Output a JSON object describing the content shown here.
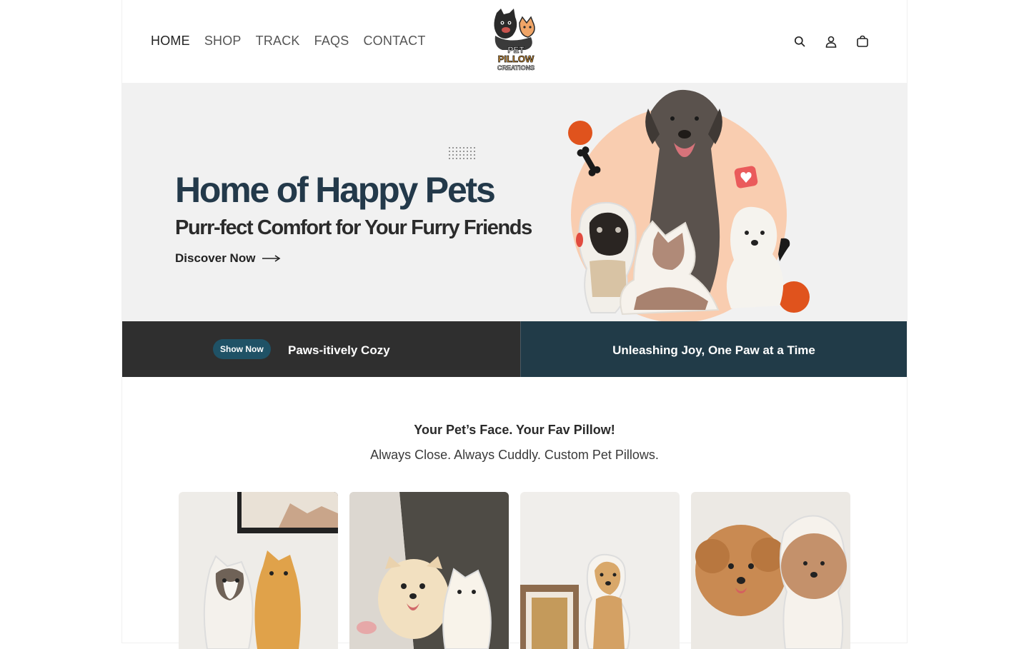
{
  "nav": {
    "items": [
      {
        "label": "HOME",
        "active": true
      },
      {
        "label": "SHOP"
      },
      {
        "label": "TRACK"
      },
      {
        "label": "FAQS"
      },
      {
        "label": "CONTACT"
      }
    ]
  },
  "logo": {
    "line1": "PET",
    "line2": "PILLOW",
    "line3": "CREATIONS"
  },
  "header_icons": [
    "search-icon",
    "account-icon",
    "cart-icon"
  ],
  "hero": {
    "title": "Home of Happy Pets",
    "subtitle": "Purr-fect Comfort for Your Furry Friends",
    "cta": "Discover Now",
    "accent_color": "#23394a",
    "circle_color": "#f9cdb0",
    "orange_color": "#e0531d"
  },
  "banner": {
    "button": "Show Now",
    "left_text": "Paws-itively Cozy",
    "right_text": "Unleashing Joy, One Paw at a Time",
    "left_bg": "#2f2f2f",
    "right_bg": "#213b48"
  },
  "section": {
    "title": "Your Pet’s Face. Your Fav Pillow!",
    "subtitle": "Always Close. Always Cuddly. Custom Pet Pillows."
  },
  "products": [
    {
      "name": "cat-pillows-card"
    },
    {
      "name": "pomeranian-pillow-card"
    },
    {
      "name": "labrador-pillow-card"
    },
    {
      "name": "poodle-pillow-card"
    }
  ]
}
